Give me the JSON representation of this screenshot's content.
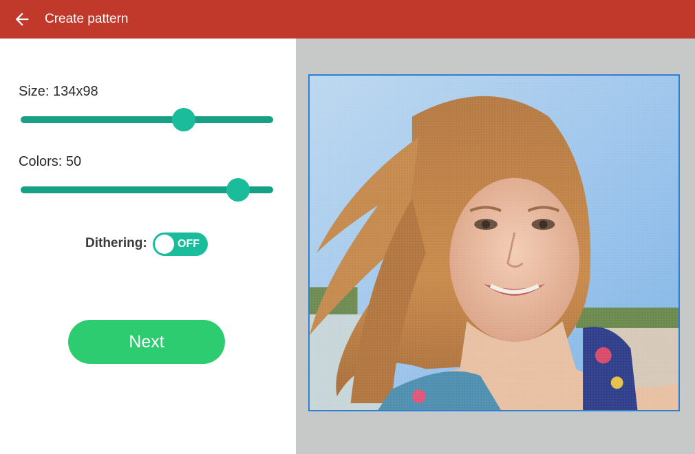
{
  "appbar": {
    "title": "Create pattern",
    "back_icon": "arrow-left-icon",
    "color": "#c0392b"
  },
  "settings": {
    "size_label": "Size: 134x98",
    "size_value": 0.645,
    "colors_label": "Colors: 50",
    "colors_value": 0.86,
    "dithering_label": "Dithering:",
    "dithering_state": "OFF",
    "accent": "#1abc9c"
  },
  "actions": {
    "next_label": "Next",
    "next_color": "#2ecc71"
  },
  "preview": {
    "image": "pixelated-portrait-photo",
    "frame_color": "#2f7fd0"
  }
}
